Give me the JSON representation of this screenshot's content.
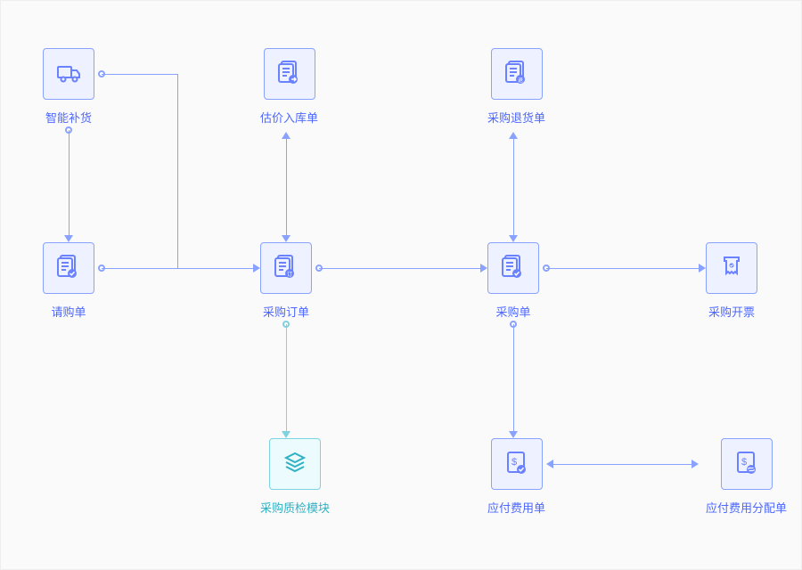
{
  "nodes": {
    "smart_restock": {
      "label": "智能补货",
      "icon": "truck-icon"
    },
    "purchase_request": {
      "label": "请购单",
      "icon": "doc-check-icon"
    },
    "estimate_inbound": {
      "label": "估价入库单",
      "icon": "doc-arrow-icon"
    },
    "purchase_order": {
      "label": "采购订单",
      "icon": "doc-order-icon"
    },
    "qc_module": {
      "label": "采购质检模块",
      "icon": "layers-icon"
    },
    "purchase_return": {
      "label": "采购退货单",
      "icon": "doc-return-icon"
    },
    "purchase_slip": {
      "label": "采购单",
      "icon": "doc-check-icon"
    },
    "payable": {
      "label": "应付费用单",
      "icon": "doc-money-icon"
    },
    "invoice": {
      "label": "采购开票",
      "icon": "receipt-icon"
    },
    "payable_alloc": {
      "label": "应付费用分配单",
      "icon": "doc-swap-icon"
    }
  }
}
